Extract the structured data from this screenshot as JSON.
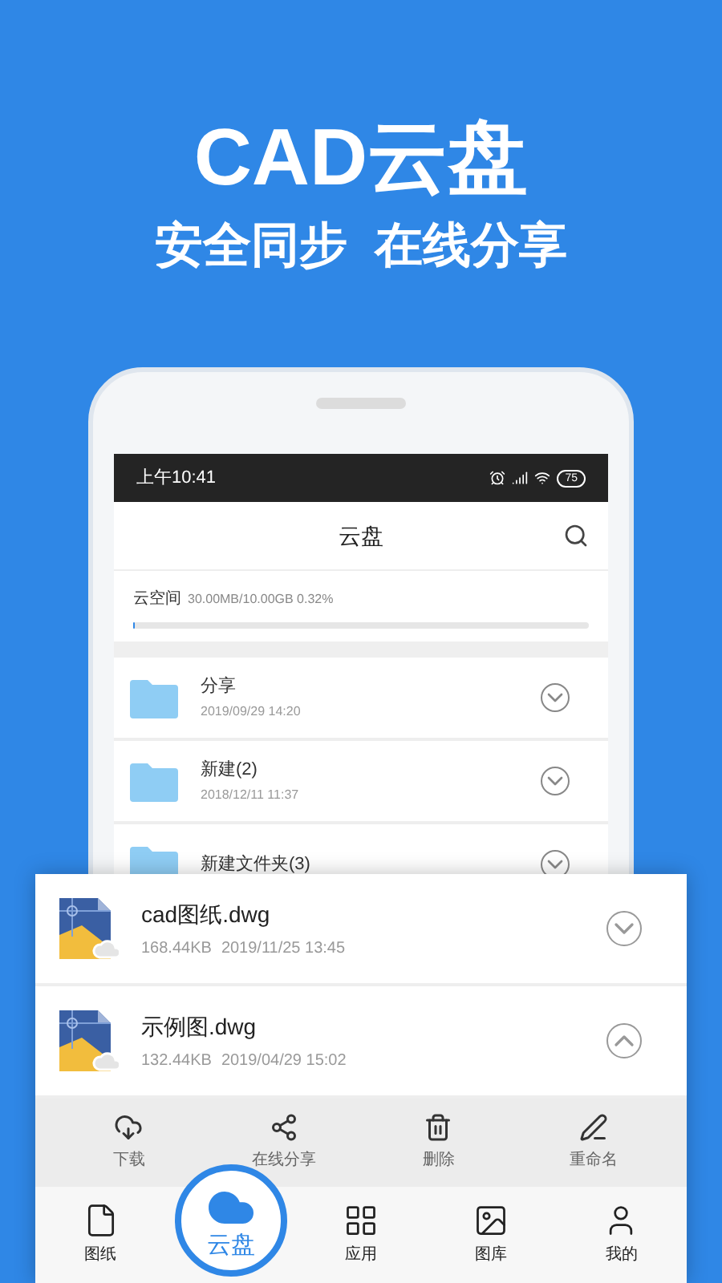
{
  "headline": {
    "title": "CAD云盘",
    "subtitle": "安全同步  在线分享"
  },
  "status_bar": {
    "time": "上午10:41",
    "battery": "75"
  },
  "header": {
    "title": "云盘"
  },
  "storage": {
    "label": "云空间",
    "usage": "30.00MB/10.00GB 0.32%",
    "level": 0.0032
  },
  "folders": [
    {
      "name": "分享",
      "date": "2019/09/29 14:20"
    },
    {
      "name": "新建(2)",
      "date": "2018/12/11 11:37"
    },
    {
      "name": "新建文件夹(3)"
    }
  ],
  "files": [
    {
      "name": "cad图纸.dwg",
      "size": "168.44KB",
      "date": "2019/11/25 13:45",
      "expanded": false
    },
    {
      "name": "示例图.dwg",
      "size": "132.44KB",
      "date": "2019/04/29 15:02",
      "expanded": true
    }
  ],
  "actions": [
    {
      "kind": "download",
      "label": "下载"
    },
    {
      "kind": "share",
      "label": "在线分享"
    },
    {
      "kind": "delete",
      "label": "删除"
    },
    {
      "kind": "rename",
      "label": "重命名"
    }
  ],
  "nav": [
    {
      "kind": "drawings",
      "label": "图纸",
      "selected": false
    },
    {
      "kind": "cloud",
      "label": "云盘",
      "selected": true
    },
    {
      "kind": "apps",
      "label": "应用",
      "selected": false
    },
    {
      "kind": "gallery",
      "label": "图库",
      "selected": false
    },
    {
      "kind": "profile",
      "label": "我的",
      "selected": false
    }
  ]
}
